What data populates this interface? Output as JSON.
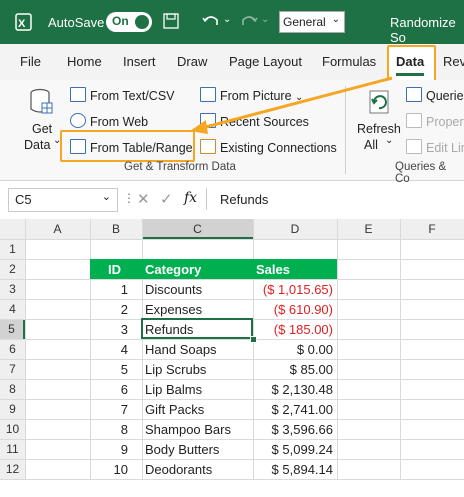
{
  "titlebar": {
    "autosave": "AutoSave",
    "toggle": "On",
    "number_format": "General",
    "title": "Randomize So"
  },
  "menu": [
    "File",
    "Home",
    "Insert",
    "Draw",
    "Page Layout",
    "Formulas",
    "Data",
    "Rev"
  ],
  "ribbon": {
    "get_data_1": "Get",
    "get_data_2": "Data",
    "from_text_csv": "From Text/CSV",
    "from_web": "From Web",
    "from_table_range": "From Table/Range",
    "from_picture": "From Picture",
    "recent_sources": "Recent Sources",
    "existing_connections": "Existing Connections",
    "refresh_1": "Refresh",
    "refresh_2": "All",
    "queries": "Queries",
    "properties": "Propert",
    "edit_links": "Edit Lin",
    "group_get_transform": "Get & Transform Data",
    "group_queries": "Queries & Co"
  },
  "formula_bar": {
    "name_box": "C5",
    "fx": "fx",
    "content": "Refunds"
  },
  "columns": [
    "A",
    "B",
    "C",
    "D",
    "E",
    "F"
  ],
  "rows": [
    "1",
    "2",
    "3",
    "4",
    "5",
    "6",
    "7",
    "8",
    "9",
    "10",
    "11",
    "12"
  ],
  "table": {
    "headers": [
      "ID",
      "Category",
      "Sales"
    ],
    "rows": [
      [
        "1",
        "Discounts",
        "($ 1,015.65)"
      ],
      [
        "2",
        "Expenses",
        "($ 610.90)"
      ],
      [
        "3",
        "Refunds",
        "($ 185.00)"
      ],
      [
        "4",
        "Hand Soaps",
        "$ 0.00"
      ],
      [
        "5",
        "Lip Scrubs",
        "$ 85.00"
      ],
      [
        "6",
        "Lip Balms",
        "$ 2,130.48"
      ],
      [
        "7",
        "Gift Packs",
        "$ 2,741.00"
      ],
      [
        "8",
        "Shampoo Bars",
        "$ 3,596.66"
      ],
      [
        "9",
        "Body Butters",
        "$ 5,099.24"
      ],
      [
        "10",
        "Deodorants",
        "$ 5,894.14"
      ]
    ],
    "negative_color": "#e02020",
    "header_color": "#00b050"
  },
  "colors": {
    "excel_green": "#1e7145",
    "highlight": "#f5a623"
  }
}
